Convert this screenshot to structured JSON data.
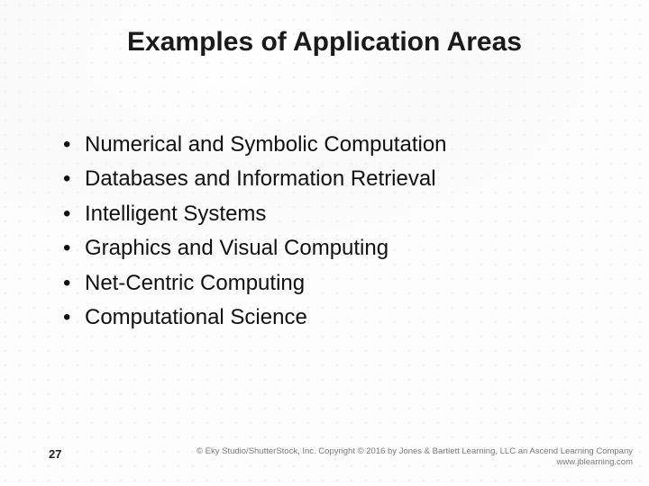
{
  "title": "Examples of Application Areas",
  "bullets": [
    "Numerical and Symbolic Computation",
    "Databases and Information Retrieval",
    "Intelligent Systems",
    "Graphics and Visual Computing",
    "Net-Centric Computing",
    "Computational Science"
  ],
  "page_number": "27",
  "footer_line1": "© Eky Studio/ShutterStock, Inc. Copyright © 2016 by Jones & Bartlett Learning, LLC an Ascend Learning Company",
  "footer_line2": "www.jblearning.com"
}
